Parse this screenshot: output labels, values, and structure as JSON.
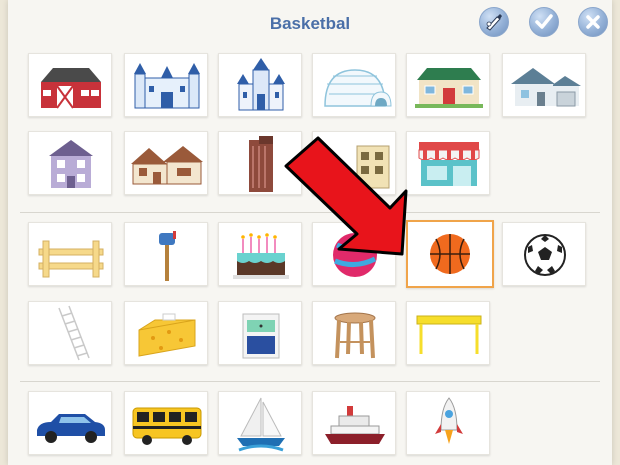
{
  "header": {
    "title": "Basketbal"
  },
  "toolbar": {
    "paint_icon": "paint-brush-icon",
    "confirm_icon": "checkmark-icon",
    "close_icon": "close-icon"
  },
  "selected_item": "basketball",
  "colors": {
    "accent": "#4a6fa8",
    "selection_border": "#f0a44a",
    "arrow_red": "#e8141b"
  }
}
